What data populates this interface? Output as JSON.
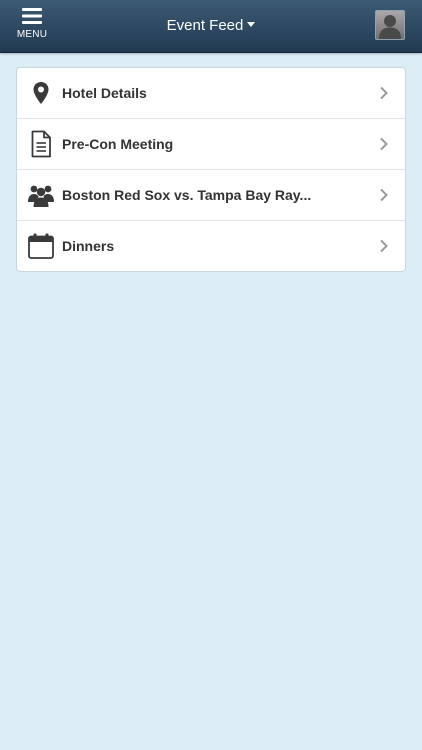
{
  "header": {
    "menu_label": "MENU",
    "title": "Event Feed"
  },
  "feed": {
    "items": [
      {
        "label": "Hotel Details",
        "icon": "map-marker-icon"
      },
      {
        "label": "Pre-Con Meeting",
        "icon": "document-icon"
      },
      {
        "label": "Boston Red Sox vs. Tampa Bay Ray...",
        "icon": "group-icon"
      },
      {
        "label": "Dinners",
        "icon": "calendar-icon"
      }
    ]
  },
  "colors": {
    "navbar": "#2e4a64",
    "background": "#dcedf5",
    "text": "#333333",
    "icon": "#333333",
    "chevron": "#999999"
  }
}
